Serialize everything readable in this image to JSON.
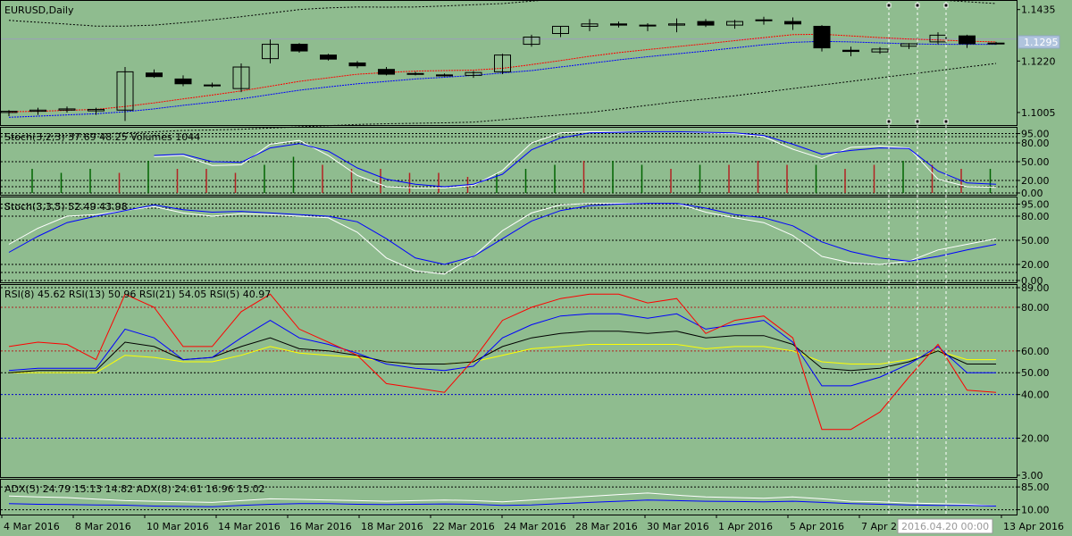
{
  "panels": {
    "price": {
      "label": "EURUSD,Daily",
      "ticks": [
        "1.1435",
        "1.1220",
        "1.1005"
      ],
      "current_price": "1.1295"
    },
    "stoch1": {
      "label": "Stoch(3,2,3) 37.69 48.25 Volumes 1044",
      "ticks": [
        "95.00",
        "80.00",
        "50.00",
        "20.00",
        "0.00"
      ]
    },
    "stoch2": {
      "label": "Stoch(3,3,5) 52.49 43.98",
      "ticks": [
        "95.00",
        "80.00",
        "50.00",
        "20.00",
        "0.00"
      ]
    },
    "rsi": {
      "label": "RSI(8) 45.62 RSI(13) 50.96 RSI(21) 54.05 RSI(5) 40.97",
      "ticks": [
        "89.00",
        "80.00",
        "60.00",
        "50.00",
        "40.00",
        "20.00",
        "3.00"
      ]
    },
    "adx": {
      "label": "ADX(5) 24.79 15.13 14.82 ADX(8) 24.61 16.96 15.02",
      "ticks": [
        "85.00",
        "10.00"
      ]
    }
  },
  "xaxis": {
    "dates": [
      "4 Mar 2016",
      "8 Mar 2016",
      "10 Mar 2016",
      "14 Mar 2016",
      "16 Mar 2016",
      "18 Mar 2016",
      "22 Mar 2016",
      "24 Mar 2016",
      "28 Mar 2016",
      "30 Mar 2016",
      "1 Apr 2016",
      "5 Apr 2016",
      "7 Apr 2016",
      "13 Apr 2016"
    ],
    "cursor_label": "2016.04.20 00:00"
  },
  "colors": {
    "background": "#8fbc8f",
    "bull_volume": "#006400",
    "bear_volume": "#b22222",
    "stoch_main": "#0000ff",
    "stoch_signal": "#ffffff",
    "rsi8": "#ff0000",
    "rsi13": "#0000ff",
    "rsi21": "#ffff00",
    "rsi5": "#000000",
    "ma_fast": "#ff0000",
    "ma_slow": "#0000ff"
  },
  "chart_data": [
    {
      "type": "candlestick",
      "title": "EURUSD,Daily",
      "ylim": [
        1.096,
        1.146
      ],
      "candles": [
        {
          "o": 1.1005,
          "h": 1.1015,
          "l": 1.099,
          "c": 1.101
        },
        {
          "o": 1.101,
          "h": 1.1025,
          "l": 1.0995,
          "c": 1.1015
        },
        {
          "o": 1.1015,
          "h": 1.103,
          "l": 1.1005,
          "c": 1.102
        },
        {
          "o": 1.1012,
          "h": 1.1025,
          "l": 1.0995,
          "c": 1.1018
        },
        {
          "o": 1.1015,
          "h": 1.1195,
          "l": 1.097,
          "c": 1.1175
        },
        {
          "o": 1.117,
          "h": 1.1185,
          "l": 1.115,
          "c": 1.1155
        },
        {
          "o": 1.1145,
          "h": 1.116,
          "l": 1.1115,
          "c": 1.1125
        },
        {
          "o": 1.1118,
          "h": 1.113,
          "l": 1.111,
          "c": 1.112
        },
        {
          "o": 1.1105,
          "h": 1.121,
          "l": 1.109,
          "c": 1.1195
        },
        {
          "o": 1.123,
          "h": 1.131,
          "l": 1.121,
          "c": 1.129
        },
        {
          "o": 1.129,
          "h": 1.1295,
          "l": 1.1255,
          "c": 1.1262
        },
        {
          "o": 1.1245,
          "h": 1.125,
          "l": 1.1222,
          "c": 1.1228
        },
        {
          "o": 1.1212,
          "h": 1.122,
          "l": 1.119,
          "c": 1.12
        },
        {
          "o": 1.1185,
          "h": 1.1195,
          "l": 1.116,
          "c": 1.1165
        },
        {
          "o": 1.1168,
          "h": 1.1175,
          "l": 1.116,
          "c": 1.1165
        },
        {
          "o": 1.1162,
          "h": 1.1168,
          "l": 1.1155,
          "c": 1.1158
        },
        {
          "o": 1.116,
          "h": 1.1178,
          "l": 1.115,
          "c": 1.1172
        },
        {
          "o": 1.1175,
          "h": 1.125,
          "l": 1.1165,
          "c": 1.1245
        },
        {
          "o": 1.129,
          "h": 1.133,
          "l": 1.128,
          "c": 1.132
        },
        {
          "o": 1.1335,
          "h": 1.1365,
          "l": 1.132,
          "c": 1.1365
        },
        {
          "o": 1.1365,
          "h": 1.1395,
          "l": 1.1345,
          "c": 1.1375
        },
        {
          "o": 1.1375,
          "h": 1.1385,
          "l": 1.136,
          "c": 1.137
        },
        {
          "o": 1.137,
          "h": 1.1378,
          "l": 1.1345,
          "c": 1.1368
        },
        {
          "o": 1.137,
          "h": 1.1398,
          "l": 1.134,
          "c": 1.1375
        },
        {
          "o": 1.1385,
          "h": 1.1395,
          "l": 1.1362,
          "c": 1.137
        },
        {
          "o": 1.137,
          "h": 1.1392,
          "l": 1.1355,
          "c": 1.1385
        },
        {
          "o": 1.139,
          "h": 1.1405,
          "l": 1.1372,
          "c": 1.1392
        },
        {
          "o": 1.1385,
          "h": 1.1402,
          "l": 1.135,
          "c": 1.1375
        },
        {
          "o": 1.1365,
          "h": 1.137,
          "l": 1.126,
          "c": 1.1275
        },
        {
          "o": 1.1265,
          "h": 1.128,
          "l": 1.124,
          "c": 1.126
        },
        {
          "o": 1.1258,
          "h": 1.1278,
          "l": 1.125,
          "c": 1.127
        },
        {
          "o": 1.1282,
          "h": 1.1295,
          "l": 1.127,
          "c": 1.1292
        },
        {
          "o": 1.13,
          "h": 1.134,
          "l": 1.129,
          "c": 1.1328
        },
        {
          "o": 1.1325,
          "h": 1.133,
          "l": 1.1275,
          "c": 1.1292
        },
        {
          "o": 1.1295,
          "h": 1.13,
          "l": 1.1288,
          "c": 1.1292
        }
      ],
      "ma_fast": [
        1.1008,
        1.101,
        1.1014,
        1.1018,
        1.103,
        1.1045,
        1.1062,
        1.1078,
        1.1095,
        1.1115,
        1.1135,
        1.115,
        1.1165,
        1.1172,
        1.1178,
        1.118,
        1.1182,
        1.119,
        1.1205,
        1.1222,
        1.124,
        1.1255,
        1.1268,
        1.128,
        1.1292,
        1.1305,
        1.1318,
        1.133,
        1.1332,
        1.1325,
        1.1318,
        1.1312,
        1.1308,
        1.1303,
        1.13
      ],
      "ma_slow": [
        1.0985,
        1.099,
        1.0995,
        1.1,
        1.1008,
        1.102,
        1.1035,
        1.1048,
        1.1062,
        1.108,
        1.1098,
        1.1112,
        1.1125,
        1.1135,
        1.1145,
        1.1152,
        1.116,
        1.117,
        1.118,
        1.1195,
        1.121,
        1.1225,
        1.1238,
        1.125,
        1.1262,
        1.1275,
        1.1288,
        1.1298,
        1.1302,
        1.13,
        1.1296,
        1.1292,
        1.129,
        1.129,
        1.129
      ],
      "bb_upper": [
        1.139,
        1.1382,
        1.1374,
        1.1366,
        1.1366,
        1.137,
        1.138,
        1.1392,
        1.1405,
        1.142,
        1.1435,
        1.1442,
        1.1446,
        1.1445,
        1.1446,
        1.145,
        1.1455,
        1.146,
        1.147,
        1.148,
        1.149,
        1.15,
        1.151,
        1.1518,
        1.1522,
        1.1524,
        1.1525,
        1.152,
        1.1512,
        1.15,
        1.149,
        1.1482,
        1.1475,
        1.1468,
        1.146
      ],
      "bb_lower": [
        1.09,
        1.0905,
        1.091,
        1.0915,
        1.092,
        1.0925,
        1.093,
        1.0932,
        1.0935,
        1.094,
        1.0945,
        1.095,
        1.0955,
        1.0958,
        1.096,
        1.0962,
        1.0965,
        1.0975,
        1.0985,
        1.0995,
        1.1005,
        1.102,
        1.1035,
        1.105,
        1.1062,
        1.1075,
        1.109,
        1.1105,
        1.112,
        1.1135,
        1.115,
        1.1165,
        1.118,
        1.1195,
        1.121
      ]
    },
    {
      "type": "line",
      "title": "Stoch(3,2,3) 37.69 48.25 Volumes 1044",
      "ylim": [
        0,
        100
      ],
      "main": [
        null,
        null,
        null,
        null,
        null,
        60,
        62,
        50,
        49,
        72,
        79,
        67,
        40,
        22,
        14,
        10,
        14,
        30,
        69,
        88,
        96,
        97,
        98,
        98,
        97,
        96,
        92,
        78,
        62,
        68,
        72,
        71,
        35,
        16,
        14
      ],
      "signal": [
        null,
        null,
        null,
        null,
        null,
        58,
        60,
        44,
        45,
        78,
        84,
        60,
        28,
        10,
        8,
        8,
        12,
        36,
        80,
        96,
        98,
        98,
        98,
        98,
        96,
        95,
        90,
        70,
        55,
        73,
        75,
        72,
        22,
        10,
        9
      ],
      "volumes": [
        6,
        5,
        6,
        5,
        8,
        6,
        6,
        5,
        7,
        9,
        7,
        6,
        6,
        5,
        5,
        4,
        5,
        6,
        7,
        8,
        8,
        7,
        6,
        7,
        7,
        8,
        7,
        7,
        6,
        7,
        8,
        7,
        6,
        6,
        6
      ],
      "volume_up": [
        1,
        1,
        1,
        0,
        1,
        0,
        0,
        0,
        1,
        1,
        0,
        0,
        0,
        0,
        0,
        0,
        1,
        1,
        1,
        0,
        1,
        1,
        0,
        1,
        0,
        0,
        0,
        1,
        0,
        0,
        1,
        0,
        0,
        1,
        1
      ]
    },
    {
      "type": "line",
      "title": "Stoch(3,3,5) 52.49 43.98",
      "ylim": [
        0,
        100
      ],
      "main": [
        35,
        55,
        72,
        80,
        null,
        94,
        88,
        85,
        86,
        84,
        82,
        80,
        73,
        52,
        28,
        20,
        30,
        52,
        74,
        87,
        93,
        95,
        96,
        96,
        90,
        82,
        78,
        68,
        48,
        36,
        28,
        24,
        30,
        38,
        45
      ],
      "signal": [
        45,
        65,
        80,
        82,
        null,
        92,
        84,
        80,
        83,
        82,
        80,
        78,
        60,
        28,
        12,
        8,
        30,
        62,
        84,
        94,
        96,
        96,
        96,
        96,
        85,
        78,
        72,
        56,
        30,
        22,
        20,
        24,
        38,
        45,
        52
      ]
    },
    {
      "type": "line",
      "title": "RSI(8) 45.62 RSI(13) 50.96 RSI(21) 54.05 RSI(5) 40.97",
      "ylim": [
        3,
        89
      ],
      "series": [
        {
          "name": "RSI(8)",
          "values": [
            51,
            52,
            52,
            52,
            70,
            66,
            56,
            57,
            66,
            74,
            66,
            63,
            59,
            54,
            52,
            51,
            53,
            66,
            72,
            76,
            77,
            77,
            75,
            77,
            70,
            72,
            74,
            64,
            44,
            44,
            48,
            54,
            62,
            50,
            50
          ]
        },
        {
          "name": "RSI(13)",
          "values": [
            50,
            51,
            51,
            51,
            64,
            62,
            56,
            57,
            62,
            66,
            61,
            60,
            58,
            55,
            54,
            54,
            55,
            62,
            66,
            68,
            69,
            69,
            68,
            69,
            66,
            67,
            67,
            63,
            52,
            51,
            52,
            55,
            60,
            54,
            54
          ]
        },
        {
          "name": "RSI(21)",
          "values": [
            50,
            50,
            50,
            50,
            58,
            57,
            55,
            55,
            58,
            62,
            59,
            58,
            57,
            55,
            54,
            54,
            55,
            58,
            61,
            62,
            63,
            63,
            63,
            63,
            61,
            62,
            62,
            60,
            55,
            54,
            54,
            56,
            60,
            56,
            56
          ]
        },
        {
          "name": "RSI(5)",
          "values": [
            62,
            64,
            63,
            56,
            86,
            80,
            62,
            62,
            78,
            86,
            70,
            64,
            58,
            45,
            43,
            41,
            56,
            74,
            80,
            84,
            86,
            86,
            82,
            84,
            68,
            74,
            76,
            66,
            24,
            24,
            32,
            48,
            63,
            42,
            41
          ]
        }
      ]
    },
    {
      "type": "line",
      "title": "ADX(5) 24.79 15.13 14.82 ADX(8) 24.61 16.96 15.02",
      "ylim": [
        0,
        100
      ],
      "adx5": [
        55,
        52,
        50,
        45,
        40,
        38,
        36,
        34,
        40,
        46,
        44,
        42,
        40,
        38,
        40,
        42,
        40,
        36,
        42,
        48,
        54,
        60,
        65,
        58,
        52,
        50,
        48,
        52,
        46,
        38,
        36,
        32,
        30,
        28,
        22
      ],
      "adx8": [
        30,
        28,
        27,
        26,
        25,
        22,
        21,
        20,
        24,
        28,
        30,
        30,
        28,
        27,
        28,
        29,
        28,
        24,
        26,
        30,
        34,
        38,
        42,
        40,
        38,
        37,
        36,
        38,
        34,
        30,
        28,
        26,
        24,
        24,
        22
      ]
    }
  ]
}
